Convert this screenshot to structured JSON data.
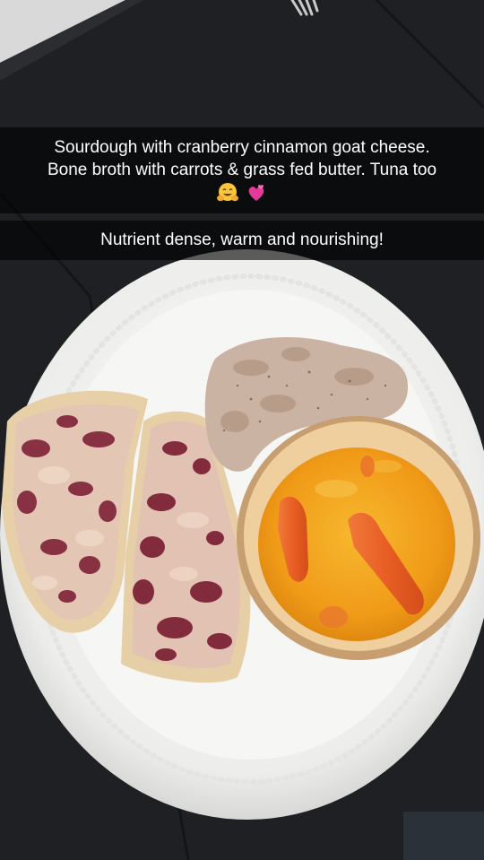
{
  "captions": {
    "first": {
      "line1": "Sourdough with cranberry cinnamon goat cheese.",
      "line2": "Bone broth with carrots & grass fed butter. Tuna too",
      "emojis": [
        "hugging-face",
        "revolving-hearts"
      ]
    },
    "second": {
      "line1": "Nutrient dense, warm and nourishing!"
    }
  },
  "colors": {
    "table": "#202124",
    "plate": "#f4f4f2",
    "broth": "#f0a21e",
    "bowl_rim": "#e8c79a",
    "carrot": "#e8652a",
    "bread": "#ead6b3",
    "cranberry": "#7a2034",
    "tuna": "#cdb7a8"
  }
}
